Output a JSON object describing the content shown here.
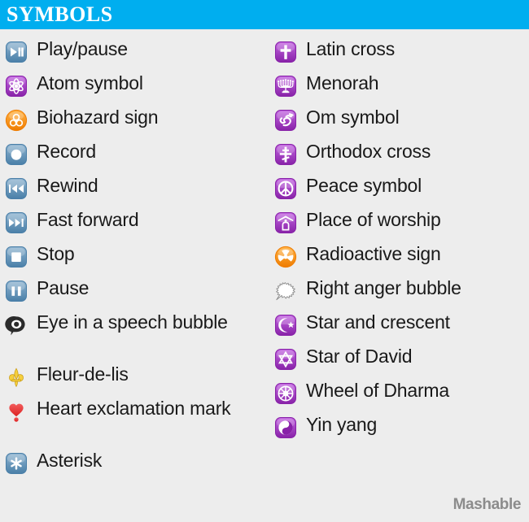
{
  "header": {
    "title": "SYMBOLS",
    "bar_color": "#00aeef",
    "text_color": "#ffffff"
  },
  "background_color": "#ededed",
  "label_color": "#191919",
  "palette": {
    "media_blue_light": "#8fb4d0",
    "media_blue_dark": "#4a7fa8",
    "purple_light": "#c266e0",
    "purple_dark": "#8822a8",
    "orange_light": "#ffb347",
    "orange_dark": "#ef7c00",
    "black": "#2b2b2b",
    "gold": "#f5cf3d",
    "red": "#dd2020",
    "bubble_white": "#ffffff",
    "bubble_outline": "#8a8a8a"
  },
  "columns": [
    {
      "name": "left-column",
      "items": [
        {
          "label": "Play/pause",
          "icon": "play-pause-icon",
          "style": "media"
        },
        {
          "label": "Atom symbol",
          "icon": "atom-symbol-icon",
          "style": "purple"
        },
        {
          "label": "Biohazard sign",
          "icon": "biohazard-sign-icon",
          "style": "orange-circle"
        },
        {
          "label": "Record",
          "icon": "record-icon",
          "style": "media"
        },
        {
          "label": "Rewind",
          "icon": "rewind-icon",
          "style": "media"
        },
        {
          "label": "Fast forward",
          "icon": "fast-forward-icon",
          "style": "media"
        },
        {
          "label": "Stop",
          "icon": "stop-icon",
          "style": "media"
        },
        {
          "label": "Pause",
          "icon": "pause-icon",
          "style": "media"
        },
        {
          "label": "Eye in a speech bubble",
          "icon": "eye-in-speech-bubble-icon",
          "style": "plain",
          "tall": true
        },
        {
          "label": "Fleur-de-lis",
          "icon": "fleur-de-lis-icon",
          "style": "plain"
        },
        {
          "label": "Heart exclamation mark",
          "icon": "heart-exclamation-icon",
          "style": "plain",
          "tall": true
        },
        {
          "label": "Asterisk",
          "icon": "asterisk-icon",
          "style": "media"
        }
      ]
    },
    {
      "name": "right-column",
      "items": [
        {
          "label": "Latin cross",
          "icon": "latin-cross-icon",
          "style": "purple"
        },
        {
          "label": "Menorah",
          "icon": "menorah-icon",
          "style": "purple"
        },
        {
          "label": "Om symbol",
          "icon": "om-symbol-icon",
          "style": "purple"
        },
        {
          "label": "Orthodox cross",
          "icon": "orthodox-cross-icon",
          "style": "purple"
        },
        {
          "label": "Peace symbol",
          "icon": "peace-symbol-icon",
          "style": "purple"
        },
        {
          "label": "Place of worship",
          "icon": "place-of-worship-icon",
          "style": "purple"
        },
        {
          "label": "Radioactive sign",
          "icon": "radioactive-sign-icon",
          "style": "orange-circle"
        },
        {
          "label": "Right anger bubble",
          "icon": "right-anger-bubble-icon",
          "style": "plain"
        },
        {
          "label": "Star and crescent",
          "icon": "star-and-crescent-icon",
          "style": "purple"
        },
        {
          "label": "Star of David",
          "icon": "star-of-david-icon",
          "style": "purple"
        },
        {
          "label": "Wheel of Dharma",
          "icon": "wheel-of-dharma-icon",
          "style": "purple"
        },
        {
          "label": "Yin yang",
          "icon": "yin-yang-icon",
          "style": "purple"
        }
      ]
    }
  ],
  "watermark": "Mashable"
}
